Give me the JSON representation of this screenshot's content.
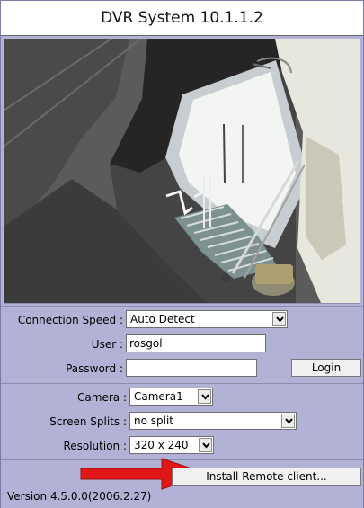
{
  "window": {
    "title": "DVR System 10.1.1.2"
  },
  "video": {
    "alt": "camera-feed"
  },
  "connection": {
    "speed_label": "Connection Speed :",
    "speed_value": "Auto Detect",
    "user_label": "User :",
    "user_value": "rosgol",
    "password_label": "Password :",
    "password_value": "",
    "login_label": "Login"
  },
  "view": {
    "camera_label": "Camera :",
    "camera_value": "Camera1",
    "splits_label": "Screen Splits :",
    "splits_value": "no split",
    "resolution_label": "Resolution :",
    "resolution_value": "320 x 240"
  },
  "footer": {
    "install_label": "Install Remote client...",
    "version_text": "Version 4.5.0.0(2006.2.27)"
  },
  "colors": {
    "panel": "#b2b2d6",
    "arrow": "#e11616"
  }
}
